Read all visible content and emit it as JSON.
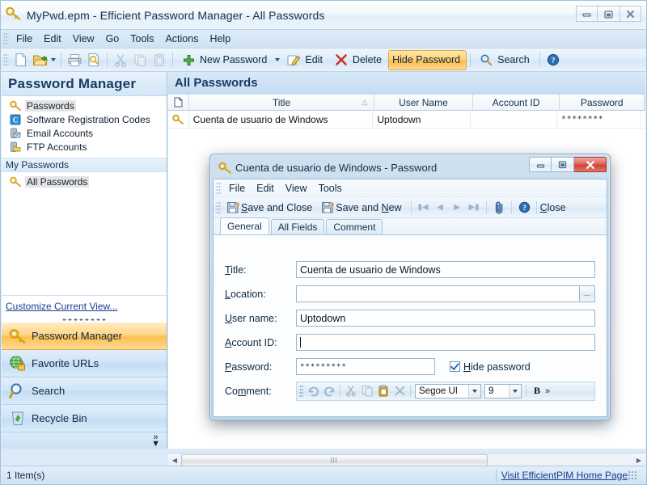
{
  "window": {
    "title": "MyPwd.epm - Efficient Password Manager - All Passwords",
    "icon": "key-icon",
    "controls": {
      "minimize": "minimize-icon",
      "maximize": "maximize-icon",
      "close": "close-icon"
    }
  },
  "menubar": {
    "items": [
      "File",
      "Edit",
      "View",
      "Go",
      "Tools",
      "Actions",
      "Help"
    ]
  },
  "toolbar": {
    "new_label": "New Password",
    "edit_label": "Edit",
    "delete_label": "Delete",
    "hide_password_label": "Hide Password",
    "search_label": "Search",
    "icons": [
      "new-document-icon",
      "open-folder-icon",
      "print-icon",
      "print-preview-icon",
      "cut-icon",
      "copy-icon",
      "paste-icon",
      "plus-icon",
      "edit-pencil-icon",
      "delete-x-icon",
      "search-magnifier-icon",
      "help-icon"
    ],
    "highlight_color": "#fcbe4e"
  },
  "sidebar": {
    "header": "Password Manager",
    "folders": [
      {
        "label": "Passwords",
        "icon": "key-icon",
        "selected": true
      },
      {
        "label": "Software Registration Codes",
        "icon": "code-c-icon",
        "selected": false
      },
      {
        "label": "Email Accounts",
        "icon": "email-server-icon",
        "selected": false
      },
      {
        "label": "FTP Accounts",
        "icon": "ftp-server-icon",
        "selected": false
      }
    ],
    "group_label": "My Passwords",
    "group_items": [
      {
        "label": "All Passwords",
        "icon": "key-icon",
        "selected": true
      }
    ],
    "customize_link": "Customize Current View...",
    "nav_buttons": [
      {
        "label": "Password Manager",
        "icon": "key-icon",
        "active": true
      },
      {
        "label": "Favorite URLs",
        "icon": "globe-lock-icon",
        "active": false
      },
      {
        "label": "Search",
        "icon": "magnifier-icon",
        "active": false
      },
      {
        "label": "Recycle Bin",
        "icon": "recycle-bin-icon",
        "active": false
      }
    ],
    "expand_icon": "chevron-double-right-icon"
  },
  "list": {
    "title": "All Passwords",
    "columns": [
      "",
      "Title",
      "User Name",
      "Account ID",
      "Password"
    ],
    "sort_column": "Title",
    "sort_direction": "ascending",
    "rows": [
      {
        "icon": "key-icon",
        "title": "Cuenta de usuario de Windows",
        "user_name": "Uptodown",
        "account_id": "",
        "password": "********"
      }
    ]
  },
  "statusbar": {
    "item_count": "1 Item(s)",
    "link": "Visit EfficientPIM Home Page"
  },
  "dialog": {
    "title": "Cuenta de usuario de Windows - Password",
    "icon": "key-icon",
    "controls": {
      "minimize": "minimize-icon",
      "maximize": "maximize-icon",
      "close": "close-icon"
    },
    "menubar": {
      "items": [
        "File",
        "Edit",
        "View",
        "Tools"
      ]
    },
    "toolbar": {
      "save_and_close": "Save and Close",
      "save_and_new": "Save and New",
      "close_label": "Close",
      "nav_icons": [
        "first-record-icon",
        "previous-record-icon",
        "next-record-icon",
        "last-record-icon"
      ],
      "attach_icon": "paperclip-icon",
      "help_icon": "help-icon"
    },
    "tabs": [
      {
        "label": "General",
        "active": true
      },
      {
        "label": "All Fields",
        "active": false
      },
      {
        "label": "Comment",
        "active": false
      }
    ],
    "fields": {
      "title_label": "Title:",
      "title_value": "Cuenta de usuario de Windows",
      "location_label": "Location:",
      "location_value": "",
      "browse_label": "...",
      "username_label": "User name:",
      "username_value": "Uptodown",
      "account_id_label": "Account ID:",
      "account_id_value": "",
      "password_label": "Password:",
      "password_value": "*********",
      "hide_password_label": "Hide password",
      "hide_password_checked": true,
      "comment_label": "Comment:"
    },
    "comment_toolbar": {
      "icons": [
        "undo-icon",
        "redo-icon",
        "cut-icon",
        "copy-icon",
        "paste-icon",
        "delete-icon"
      ],
      "font_name": "Segoe UI",
      "font_size": "9",
      "bold_label": "B",
      "overflow_label": "»"
    }
  }
}
